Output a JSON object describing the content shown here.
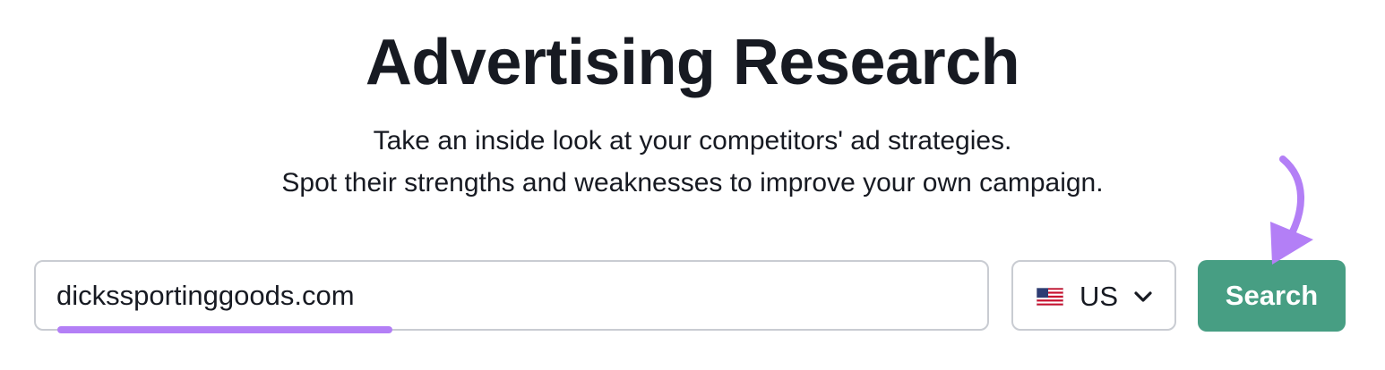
{
  "page": {
    "title": "Advertising Research",
    "subtitle_line1": "Take an inside look at your competitors' ad strategies.",
    "subtitle_line2": "Spot their strengths and weaknesses to improve your own campaign."
  },
  "search": {
    "value": "dickssportinggoods.com"
  },
  "database": {
    "selected": "US",
    "flag_icon": "us-flag-icon",
    "chevron_icon": "chevron-down-icon"
  },
  "actions": {
    "search_label": "Search"
  },
  "colors": {
    "accent": "#b37ff6",
    "button": "#479e83",
    "text": "#171a22",
    "border": "#c9ccd2"
  }
}
